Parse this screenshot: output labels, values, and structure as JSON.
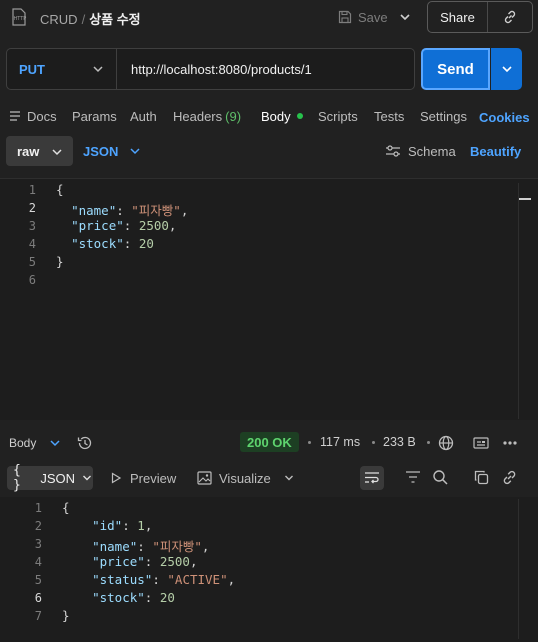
{
  "header": {
    "breadcrumb_collection": "CRUD",
    "breadcrumb_separator": "/",
    "request_name": "상품 수정",
    "save_label": "Save",
    "share_label": "Share"
  },
  "request": {
    "method": "PUT",
    "url": "http://localhost:8080/products/1",
    "send_label": "Send"
  },
  "tabs": [
    {
      "label": "Docs"
    },
    {
      "label": "Params"
    },
    {
      "label": "Auth"
    },
    {
      "label": "Headers",
      "count": "(9)"
    },
    {
      "label": "Body",
      "active": true
    },
    {
      "label": "Scripts"
    },
    {
      "label": "Tests"
    },
    {
      "label": "Settings"
    },
    {
      "label": "Cookies"
    }
  ],
  "body_options": {
    "mode": "raw",
    "format": "JSON",
    "schema_label": "Schema",
    "beautify_label": "Beautify"
  },
  "request_body_lines": [
    "1",
    "2",
    "3",
    "4",
    "5",
    "6"
  ],
  "request_body": {
    "name_key": "\"name\"",
    "name_value": "\"피자빵\"",
    "price_key": "\"price\"",
    "price_value": "2500",
    "stock_key": "\"stock\"",
    "stock_value": "20"
  },
  "response": {
    "section_label": "Body",
    "status": "200 OK",
    "time": "117 ms",
    "size": "233 B",
    "view_format": "JSON",
    "preview_label": "Preview",
    "visualize_label": "Visualize",
    "lines": [
      "1",
      "2",
      "3",
      "4",
      "5",
      "6",
      "7"
    ],
    "id_key": "\"id\"",
    "id_value": "1",
    "name_key": "\"name\"",
    "name_value": "\"피자빵\"",
    "price_key": "\"price\"",
    "price_value": "2500",
    "status_key": "\"status\"",
    "status_value": "\"ACTIVE\"",
    "stock_key": "\"stock\"",
    "stock_value": "20"
  },
  "icons": {
    "http": "http-file-icon",
    "save": "save-disk-icon",
    "link": "link-icon",
    "history": "history-icon",
    "globe": "globe-icon",
    "schema": "sliders-icon",
    "wrap": "wrap-lines-icon",
    "filter": "filter-icon",
    "search": "search-icon",
    "copy": "copy-icon",
    "more": "more-icon"
  },
  "colors": {
    "accent": "#4ea4ff",
    "send": "#0f6fd6",
    "status_ok": "#5ed46e",
    "background": "#212121"
  }
}
